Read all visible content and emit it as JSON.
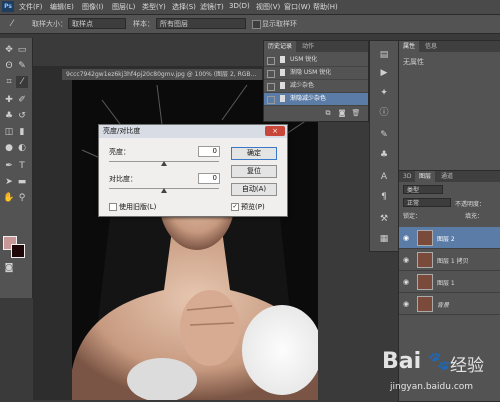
{
  "app": {
    "logo": "Ps"
  },
  "menu": [
    "文件(F)",
    "编辑(E)",
    "图像(I)",
    "图层(L)",
    "类型(Y)",
    "选择(S)",
    "滤镜(T)",
    "3D(D)",
    "视图(V)",
    "窗口(W)",
    "帮助(H)"
  ],
  "options": {
    "sample_size_label": "取样大小：",
    "sample_size_value": "取样点",
    "sample_label": "样本：",
    "sample_value": "所有图层",
    "ring_label": "显示取样环"
  },
  "document": {
    "tab_title": "9ccc7942gw1ez6kj3hf4pj20c80gmv.jpg @ 100% (图层 2, RGB...",
    "tab_close": "×"
  },
  "dialog": {
    "title": "亮度/对比度",
    "close": "×",
    "brightness_label": "亮度：",
    "brightness_value": "0",
    "contrast_label": "对比度：",
    "contrast_value": "0",
    "ok": "确定",
    "reset": "复位",
    "auto": "自动(A)",
    "legacy_label": "使用旧版(L)",
    "preview_label": "预览(P)",
    "preview_checked": "✓"
  },
  "history": {
    "tabs": [
      "历史记录",
      "动作"
    ],
    "items": [
      "USM 锐化",
      "渐隐 USM 锐化",
      "减少杂色",
      "渐隐减少杂色"
    ],
    "selected_index": 3
  },
  "properties": {
    "tabs": [
      "属性",
      "信息"
    ],
    "empty_text": "无属性"
  },
  "layers": {
    "tabs": [
      "3D",
      "图层",
      "通道"
    ],
    "kind_label": "类型",
    "blend_mode": "正常",
    "opacity_label": "不透明度：",
    "lock_label": "锁定：",
    "fill_label": "填充：",
    "rows": [
      {
        "name": "图层 2",
        "selected": true
      },
      {
        "name": "图层 1 拷贝",
        "selected": false
      },
      {
        "name": "图层 1",
        "selected": false
      },
      {
        "name": "背景",
        "selected": false
      }
    ]
  },
  "watermark": {
    "brand": "Bai",
    "brand_cn": "经验",
    "url": "jingyan.baidu.com"
  },
  "colors": {
    "foreground": "#c89898",
    "background": "#200707",
    "selection": "#5b7ca6",
    "panel": "#535353"
  }
}
